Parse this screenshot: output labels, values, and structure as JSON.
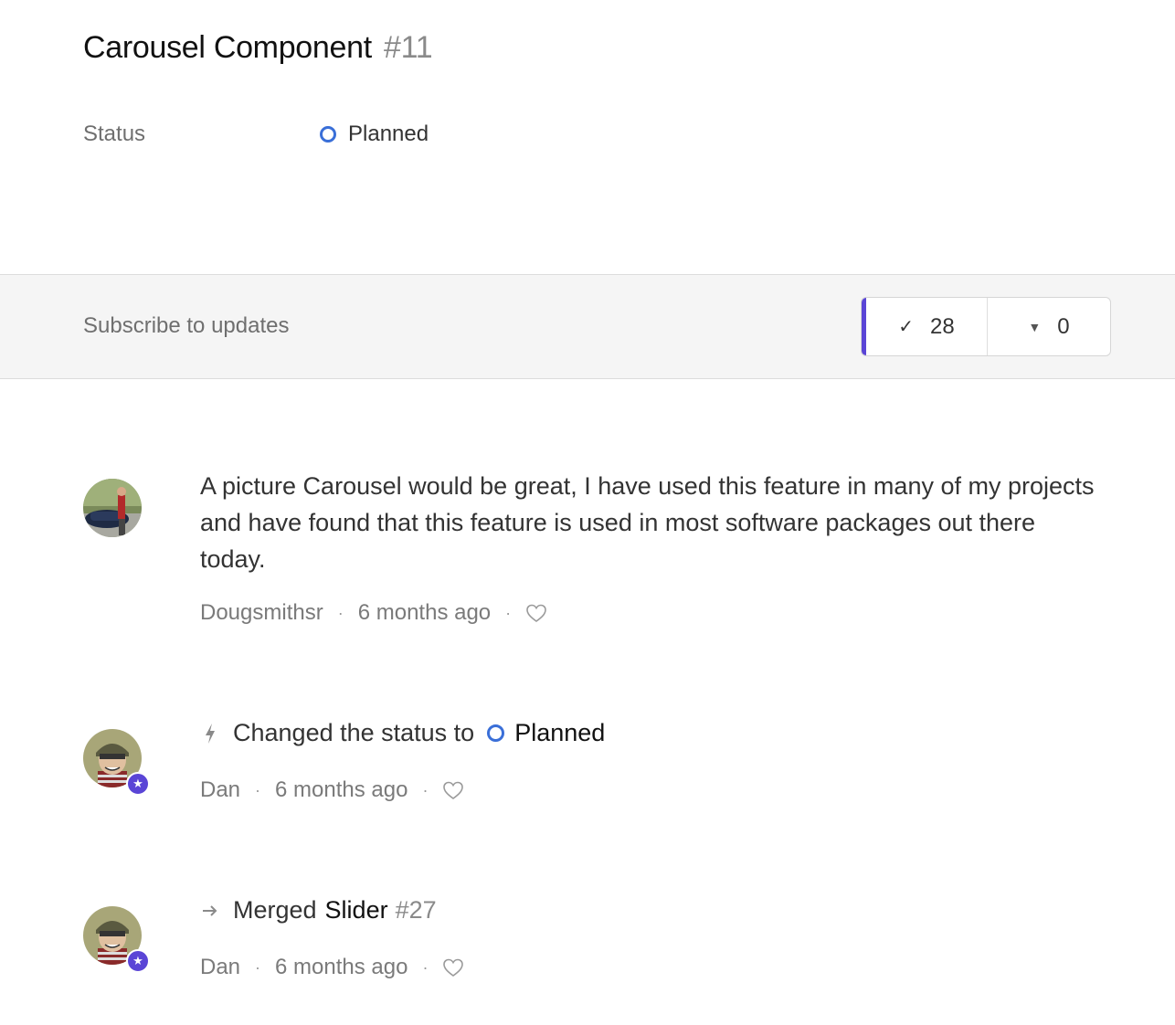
{
  "post": {
    "title": "Carousel Component",
    "number": "#11",
    "status_label": "Status",
    "status_value": "Planned",
    "status_color": "#3a6fd8"
  },
  "subscribe": {
    "label": "Subscribe to updates",
    "upvote_icon": "check-icon",
    "upvotes": "28",
    "downvote_icon": "triangle-down-icon",
    "downvotes": "0",
    "accent_color": "#5a45d6"
  },
  "comments": [
    {
      "text": "A picture Carousel would be great, I have used this feature in many of my projects and have found that this feature is used in most software packages out there today.",
      "author": "Dougsmithsr",
      "time": "6 months ago",
      "like_icon": "heart-icon"
    }
  ],
  "activities": [
    {
      "icon": "lightning-icon",
      "prefix": "Changed the status to",
      "status": "Planned",
      "author": "Dan",
      "time": "6 months ago",
      "like_icon": "heart-icon",
      "badge_icon": "star-icon"
    },
    {
      "icon": "arrow-right-icon",
      "prefix": "Merged",
      "target": "Slider",
      "target_number": "#27",
      "author": "Dan",
      "time": "6 months ago",
      "like_icon": "heart-icon",
      "badge_icon": "star-icon"
    }
  ]
}
